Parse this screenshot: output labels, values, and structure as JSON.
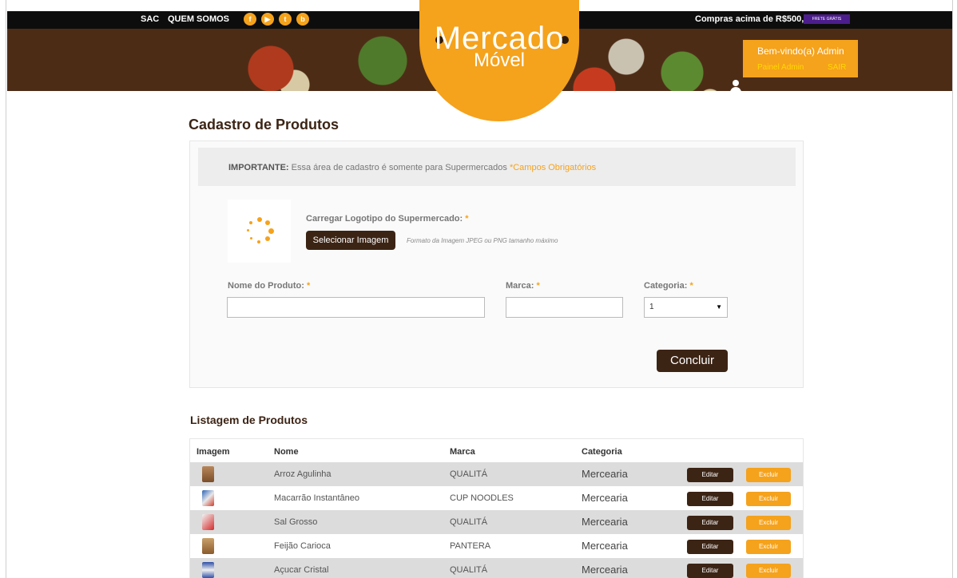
{
  "topbar": {
    "links": [
      "SAC",
      "QUEM SOMOS"
    ],
    "social": [
      {
        "icon": "facebook-icon",
        "glyph": "f"
      },
      {
        "icon": "youtube-icon",
        "glyph": "▶"
      },
      {
        "icon": "twitter-icon",
        "glyph": "t"
      },
      {
        "icon": "blogger-icon",
        "glyph": "b"
      }
    ],
    "promo_text": "Compras acima de R$500,00",
    "promo_badge": "FRETE GRÁTIS"
  },
  "brand": {
    "line1": "Mercado",
    "line2": "Móvel"
  },
  "user": {
    "welcome": "Bem-vindo(a) Admin",
    "admin_link": "Painel Admin",
    "logout": "SAIR"
  },
  "form": {
    "title": "Cadastro de Produtos",
    "notice_strong": "IMPORTANTE:",
    "notice_text": " Essa área de cadastro é somente para Supermercados ",
    "notice_required": "*Campos Obrigatórios",
    "logo_label": "Carregar Logotipo do Supermercado:",
    "select_image": "Selecionar Imagem",
    "format_hint": "Formato da Imagem JPEG ou PNG tamanho máximo",
    "product_label": "Nome do Produto:",
    "brand_label": "Marca:",
    "category_label": "Categoria:",
    "required_mark": "*",
    "product_value": "",
    "brand_value": "",
    "category_value": "1",
    "submit": "Concluir"
  },
  "list": {
    "title": "Listagem de Produtos",
    "headers": [
      "Imagem",
      "Nome",
      "Marca",
      "Categoria"
    ],
    "rows": [
      {
        "name": "Arroz Agulinha",
        "brand": "QUALITÁ",
        "category": "Mercearia",
        "edit": "Editar",
        "delete": "Excluir"
      },
      {
        "name": "Macarrão Instantâneo",
        "brand": "CUP NOODLES",
        "category": "Mercearia",
        "edit": "Editar",
        "delete": "Excluir"
      },
      {
        "name": "Sal Grosso",
        "brand": "QUALITÁ",
        "category": "Mercearia",
        "edit": "Editar",
        "delete": "Excluir"
      },
      {
        "name": "Feijão Carioca",
        "brand": "PANTERA",
        "category": "Mercearia",
        "edit": "Editar",
        "delete": "Excluir"
      },
      {
        "name": "Açucar Cristal",
        "brand": "QUALITÁ",
        "category": "Mercearia",
        "edit": "Editar",
        "delete": "Excluir"
      }
    ]
  },
  "colors": {
    "brand_brown": "#3c2415",
    "accent_orange": "#f5a21c",
    "topbar": "#0d0d0d"
  }
}
